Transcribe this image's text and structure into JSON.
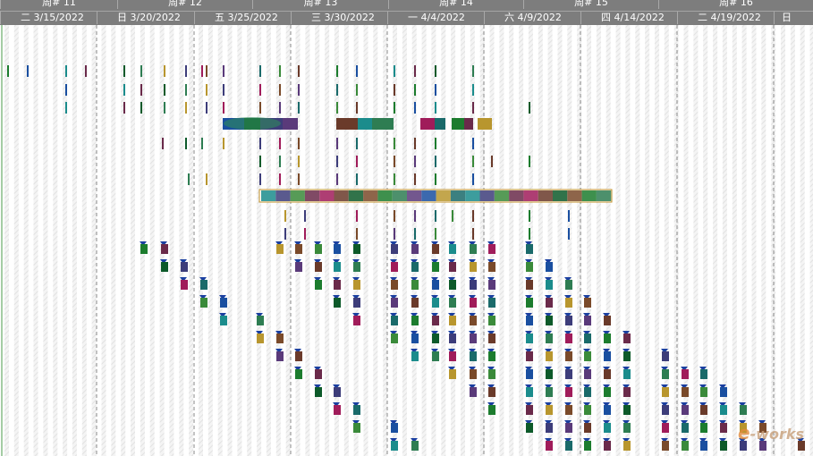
{
  "timescale": {
    "weeks": [
      "周# 11",
      "周# 12",
      "周# 13",
      "周# 14",
      "周# 15",
      "周# 16"
    ],
    "days": [
      "二 3/15/2022",
      "日 3/20/2022",
      "五 3/25/2022",
      "三 3/30/2022",
      "一 4/4/2022",
      "六 4/9/2022",
      "四 4/14/2022",
      "二 4/19/2022",
      "日"
    ]
  },
  "watermark": {
    "e": "e",
    "rest": "-works"
  },
  "colors": {
    "header_bg": "#7d7d7d",
    "palette": [
      "#1c7c2e",
      "#1a4fa0",
      "#1b8c8c",
      "#6a2a4a",
      "#0d5a2a",
      "#2e7d52",
      "#b8962e",
      "#3d3d7a",
      "#a01c5a",
      "#7a4a2a",
      "#5a3a7a",
      "#1a6a6a",
      "#3a8a3a",
      "#6a3a2a"
    ],
    "nonwork_stripe": "#e2e2e2"
  }
}
